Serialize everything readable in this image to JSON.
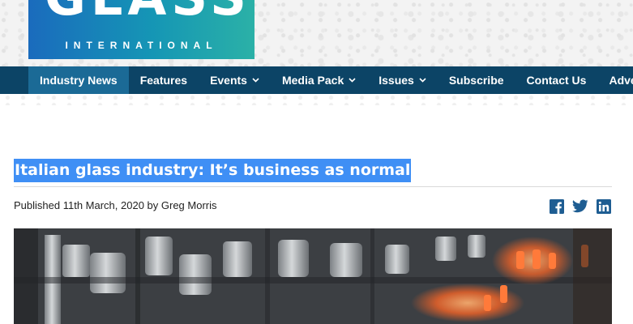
{
  "header": {
    "logo_word": "GLASS",
    "logo_subtitle": "INTERNATIONAL"
  },
  "nav": {
    "items": [
      {
        "label": "Industry News",
        "active": true,
        "dropdown": false
      },
      {
        "label": "Features",
        "active": false,
        "dropdown": false
      },
      {
        "label": "Events",
        "active": false,
        "dropdown": true
      },
      {
        "label": "Media Pack",
        "active": false,
        "dropdown": true
      },
      {
        "label": "Issues",
        "active": false,
        "dropdown": true
      },
      {
        "label": "Subscribe",
        "active": false,
        "dropdown": false
      },
      {
        "label": "Contact Us",
        "active": false,
        "dropdown": false
      },
      {
        "label": "Advertise",
        "active": false,
        "dropdown": false
      }
    ]
  },
  "article": {
    "title": "Italian glass industry: It’s business as normal",
    "byline": "Published 11th March, 2020 by Greg Morris",
    "share_icons": [
      "facebook-icon",
      "twitter-icon",
      "linkedin-icon"
    ]
  },
  "colors": {
    "nav_bg": "#0c4466",
    "nav_active": "#1b6a96",
    "title_highlight": "#3f8ff5",
    "share_blue": "#1e5d92"
  }
}
